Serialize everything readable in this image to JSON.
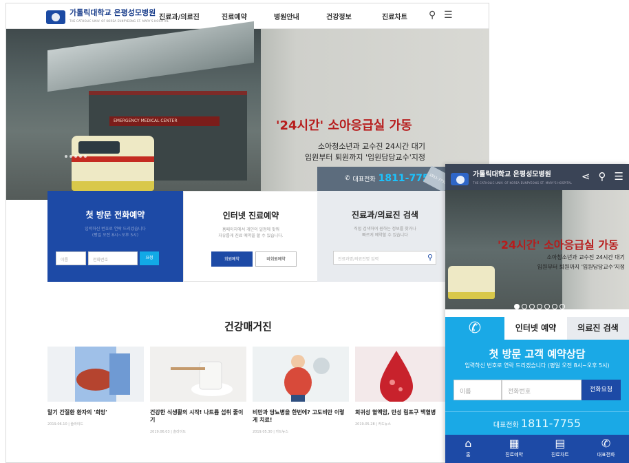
{
  "header": {
    "logo_title": "가톨릭대학교 은평성모병원",
    "logo_sub": "THE CATHOLIC UNIV. OF KOREA EUNPYEONG ST. MARY'S HOSPITAL",
    "menu": [
      "진료과/의료진",
      "진료예약",
      "병원안내",
      "건강정보",
      "진료차트"
    ],
    "icons": [
      "search-icon",
      "menu-icon"
    ]
  },
  "hero": {
    "title": "'24시간' 소아응급실 가동",
    "sub1": "소아청소년과 교수진 24시간 대기",
    "sub2": "입원부터 퇴원까지 '입원담당교수'지정",
    "building_sign": "EMERGENCY MEDICAL CENTER",
    "phone_label": "대표전화",
    "phone_number": "1811-7755",
    "badge": "1811-7755"
  },
  "panels": {
    "first_visit": {
      "title": "첫 방문 전화예약",
      "desc1": "입력하신 번호로 연락 드리겠습니다",
      "desc2": "(평일 오전 8시~오후 5시)",
      "name_placeholder": "이름",
      "phone_placeholder": "전화번호",
      "submit": "요청"
    },
    "internet": {
      "title": "인터넷 진료예약",
      "desc1": "홈페이지에서 개인의 일정에 맞춰",
      "desc2": "자유롭게 진료 예약을 할 수 있습니다.",
      "member": "회원예약",
      "non_member": "비회원예약"
    },
    "search": {
      "title": "진료과/의료진 검색",
      "desc1": "직접 검색하여 원하는 정보를 찾거나",
      "desc2": "빠르게 예약할 수 있습니다",
      "placeholder": "진료과명/의료진명 입력"
    }
  },
  "magazine": {
    "title": "건강매거진",
    "cards": [
      {
        "title": "말기 간질환 환자의 '희망'",
        "date": "2019.06.10",
        "source": "슬라이드"
      },
      {
        "title": "건강한 식생활의 시작! 나트륨 섭취 줄이기",
        "date": "2019.06.03",
        "source": "슬라이드"
      },
      {
        "title": "비만과 당뇨병을 한번에? 고도비만 이렇게 치료!",
        "date": "2019.05.30",
        "source": "카드뉴스"
      },
      {
        "title": "희귀성 혈액암, 만성 림프구 백혈병",
        "date": "2019.05.28",
        "source": "카드뉴스"
      }
    ]
  },
  "mobile": {
    "logo_title": "가톨릭대학교 은평성모병원",
    "logo_sub": "THE CATHOLIC UNIV. OF KOREA EUNPYEONG ST. MARY'S HOSPITAL",
    "hero_title": "'24시간' 소아응급실 가동",
    "hero_sub1": "소아청소년과 교수진 24시간 대기",
    "hero_sub2": "입원부터 퇴원까지 '입원담당교수'지정",
    "tab_internet": "인터넷 예약",
    "tab_search": "의료진 검색",
    "consult_title": "첫 방문 고객 예약상담",
    "consult_desc": "입력하신 번호로 연락 드리겠습니다 (평일 오전 8시~오후 5시)",
    "name_placeholder": "이름",
    "phone_placeholder": "전화번호",
    "submit": "전화요청",
    "phone_label": "대표전화",
    "phone_number": "1811-7755",
    "bottom": [
      {
        "icon": "home-icon",
        "label": "홈"
      },
      {
        "icon": "calendar-icon",
        "label": "진료예약"
      },
      {
        "icon": "clipboard-icon",
        "label": "진료차트"
      },
      {
        "icon": "phone-icon",
        "label": "대표전화"
      }
    ]
  },
  "colors": {
    "primary": "#1d4aa6",
    "accent": "#1aa9e6",
    "hero_title": "#b71c1c",
    "gray_bar": "#5c6c7d"
  }
}
